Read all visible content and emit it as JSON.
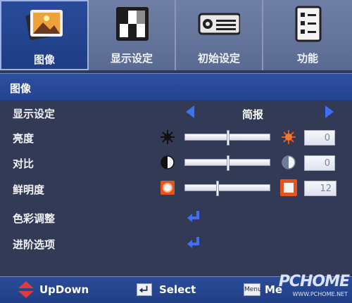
{
  "tabs": [
    {
      "label": "图像",
      "icon": "picture-icon",
      "active": true
    },
    {
      "label": "显示设定",
      "icon": "display-icon",
      "active": false
    },
    {
      "label": "初始设定",
      "icon": "projector-icon",
      "active": false
    },
    {
      "label": "功能",
      "icon": "checklist-icon",
      "active": false
    }
  ],
  "header": {
    "title": "图像"
  },
  "rows": {
    "display_mode": {
      "label": "显示设定",
      "value": "简报"
    },
    "brightness": {
      "label": "亮度",
      "value": "0",
      "level": 0.5
    },
    "contrast": {
      "label": "对比",
      "value": "0",
      "level": 0.5
    },
    "sharpness": {
      "label": "鲜明度",
      "value": "12",
      "level": 0.38
    },
    "color_adjust": {
      "label": "色彩调整"
    },
    "advanced": {
      "label": "进阶选项"
    }
  },
  "footer": {
    "updown": "UpDown",
    "select": "Select",
    "menu_key": "Menu",
    "menu": "Me",
    "watermark": "PCHOME",
    "watermark_sub": "WWW.PCHOME.NET"
  },
  "colors": {
    "accent": "#3f6ff2",
    "header": "#2d4f9f",
    "tab_bar": "#6f7fa5",
    "body": "#333a56"
  }
}
